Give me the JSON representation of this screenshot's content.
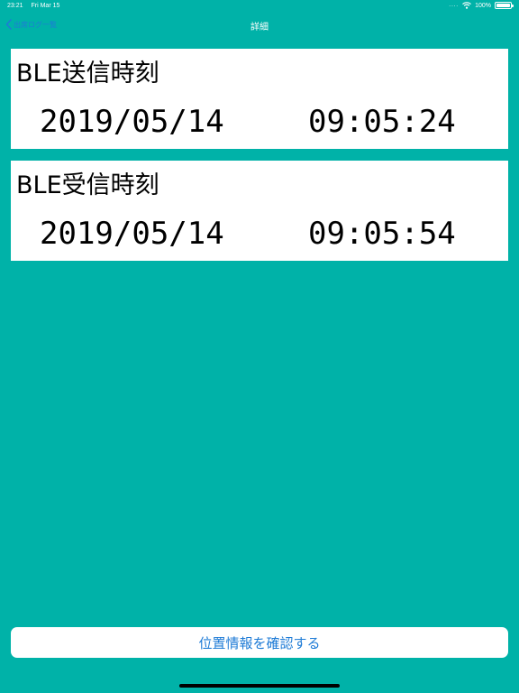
{
  "status_bar": {
    "time": "23:21",
    "date": "Fri Mar 15",
    "signal_dots": "....",
    "battery": "100%"
  },
  "nav": {
    "back_label": "出席ログ一覧",
    "title": "詳細"
  },
  "send_card": {
    "title": "BLE送信時刻",
    "date": "2019/05/14",
    "time": "09:05:24"
  },
  "receive_card": {
    "title": "BLE受信時刻",
    "date": "2019/05/14",
    "time": "09:05:54"
  },
  "confirm_button": {
    "label": "位置情報を確認する"
  },
  "colors": {
    "background": "#00B2A8",
    "accent": "#1e7bd6",
    "card": "#ffffff"
  },
  "icons": {
    "back": "chevron-left-icon",
    "wifi": "wifi-icon",
    "battery": "battery-icon"
  }
}
